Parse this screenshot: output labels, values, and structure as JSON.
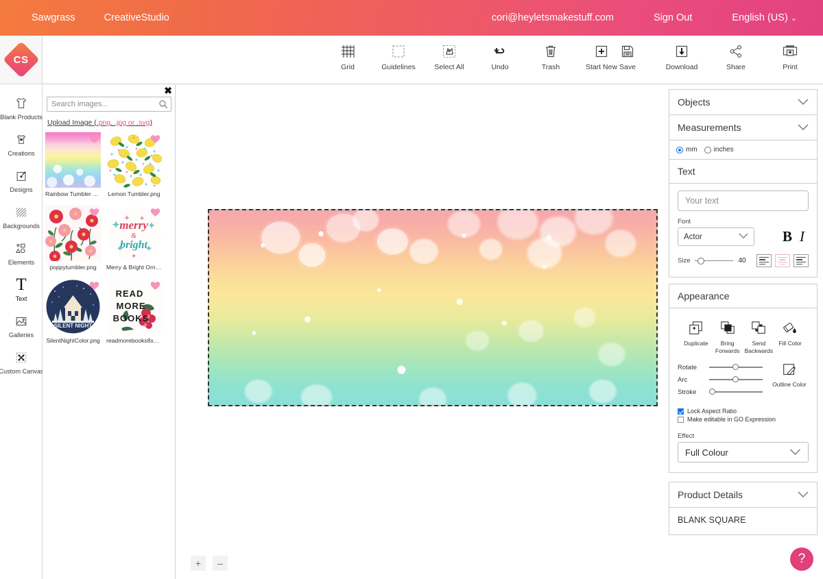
{
  "topbar": {
    "brand": "Sawgrass",
    "app": "CreativeStudio",
    "email": "cori@heyletsmakestuff.com",
    "sign_out": "Sign Out",
    "language": "English (US)",
    "caret": "⌄"
  },
  "logo": {
    "text": "CS"
  },
  "toolbar": {
    "center": [
      {
        "label": "Grid",
        "icon": "grid-icon"
      },
      {
        "label": "Guidelines",
        "icon": "guidelines-icon"
      },
      {
        "label": "Select All",
        "icon": "select-all-icon"
      },
      {
        "label": "Undo",
        "icon": "undo-icon"
      },
      {
        "label": "Trash",
        "icon": "trash-icon"
      },
      {
        "label": "Start New",
        "icon": "start-new-icon"
      }
    ],
    "right": [
      {
        "label": "Save",
        "icon": "save-icon"
      },
      {
        "label": "Download",
        "icon": "download-icon"
      },
      {
        "label": "Share",
        "icon": "share-icon"
      },
      {
        "label": "Print",
        "icon": "print-icon"
      }
    ]
  },
  "sidebar": {
    "items": [
      {
        "label": "Blank Products",
        "icon": "tshirt-icon"
      },
      {
        "label": "Creations",
        "icon": "creations-icon"
      },
      {
        "label": "Designs",
        "icon": "designs-icon"
      },
      {
        "label": "Backgrounds",
        "icon": "backgrounds-icon"
      },
      {
        "label": "Elements",
        "icon": "elements-icon"
      },
      {
        "label": "Text",
        "icon": "text-icon"
      },
      {
        "label": "Galleries",
        "icon": "galleries-icon"
      },
      {
        "label": "Custom Canvas",
        "icon": "custom-canvas-icon"
      }
    ]
  },
  "images_panel": {
    "close": "✖",
    "search_placeholder": "Search images...",
    "search_value": "",
    "upload_prefix": "Upload Image (",
    "upload_exts": ".png, .jpg or .svg",
    "upload_suffix": ")",
    "thumbnails": [
      {
        "name": "Rainbow Tumbler Wra...",
        "art": "rainbow",
        "favorite": true
      },
      {
        "name": "Lemon Tumbler.png",
        "art": "lemon",
        "favorite": true
      },
      {
        "name": "poppytumbler.png",
        "art": "poppy",
        "favorite": true
      },
      {
        "name": "Merry & Bright Ornam...",
        "art": "merry",
        "favorite": true
      },
      {
        "name": "SilentNightColor.png",
        "art": "silent",
        "favorite": true
      },
      {
        "name": "readmorebooks8x10.jpg",
        "art": "read",
        "favorite": true
      }
    ]
  },
  "canvas": {
    "zoom_in": "+",
    "zoom_out": "–",
    "artboard_description": "bokeh gradient image pink to yellow to green to teal"
  },
  "right_panel": {
    "objects": {
      "title": "Objects",
      "chevron": "⌄"
    },
    "measurements": {
      "title": "Measurements",
      "chevron": "⌄"
    },
    "units": {
      "mm": "mm",
      "inches": "inches",
      "selected": "mm"
    },
    "text": {
      "title": "Text",
      "input_placeholder": "Your text",
      "input_value": "",
      "font_label": "Font",
      "font_value": "Actor",
      "bold": "B",
      "italic": "I",
      "size_label": "Size",
      "size_value": "40",
      "align_selected": "center"
    },
    "appearance": {
      "title": "Appearance",
      "buttons": [
        {
          "label": "Duplicate",
          "icon": "duplicate-icon"
        },
        {
          "label": "Bring Forwards",
          "icon": "bring-forwards-icon"
        },
        {
          "label": "Send Backwards",
          "icon": "send-backwards-icon"
        },
        {
          "label": "Fill Color",
          "icon": "fill-color-icon"
        }
      ],
      "sliders": [
        {
          "label": "Rotate",
          "pct": 50
        },
        {
          "label": "Arc",
          "pct": 50
        },
        {
          "label": "Stroke",
          "pct": 0
        }
      ],
      "outline_color": "Outline Color",
      "lock_aspect": "Lock Aspect Ratio",
      "lock_aspect_checked": true,
      "go_expression": "Make editable in GO Expression",
      "go_expression_checked": false,
      "effect_label": "Effect",
      "effect_value": "Full Colour",
      "effect_chevron": "⌄"
    },
    "product_details": {
      "title": "Product Details",
      "chevron": "⌄",
      "value": "BLANK SQUARE"
    }
  },
  "help": {
    "label": "?"
  },
  "colors": {
    "brand_orange": "#f47b3f",
    "brand_pink": "#e2427f",
    "accent_blue": "#1a73e8",
    "help_pink": "#e0417a"
  }
}
